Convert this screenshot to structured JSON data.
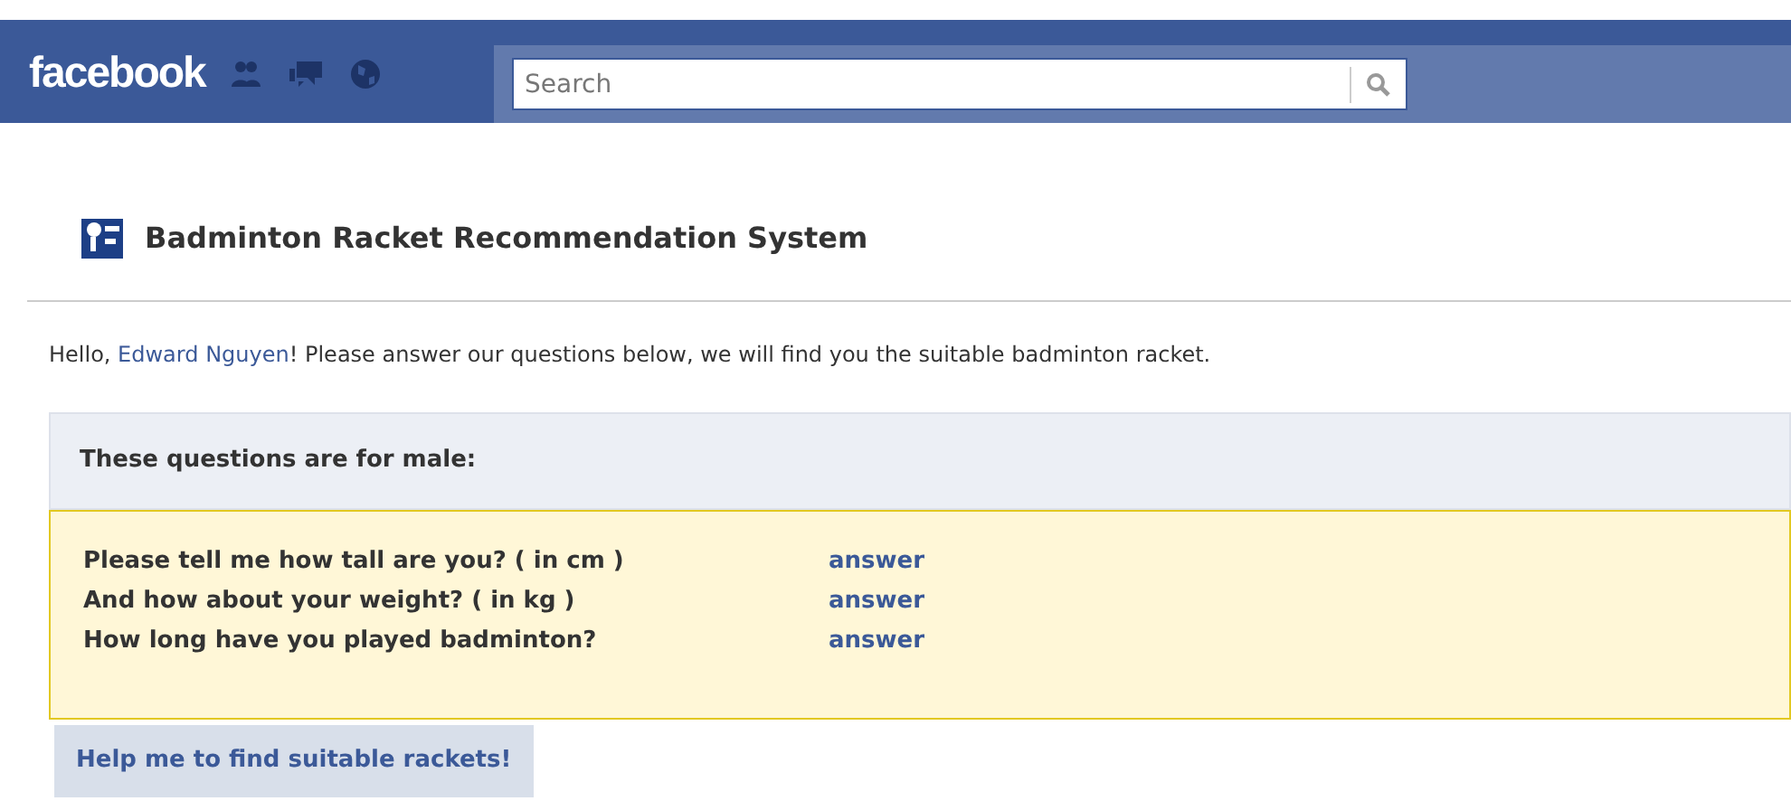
{
  "header": {
    "logo": "facebook",
    "search": {
      "placeholder": "Search"
    }
  },
  "app": {
    "title": "Badminton Racket Recommendation System"
  },
  "greeting": {
    "before": "Hello, ",
    "name": "Edward Nguyen",
    "after": "! Please answer our questions below, we will find you the suitable badminton racket."
  },
  "section_title": "These questions are for male:",
  "questions": [
    {
      "text": "Please tell me how tall are you? ( in cm )",
      "link": "answer"
    },
    {
      "text": "And how about your weight? ( in kg )",
      "link": "answer"
    },
    {
      "text": "How long have you played badminton?",
      "link": "answer"
    }
  ],
  "submit_button": "Help me to find suitable rackets!"
}
